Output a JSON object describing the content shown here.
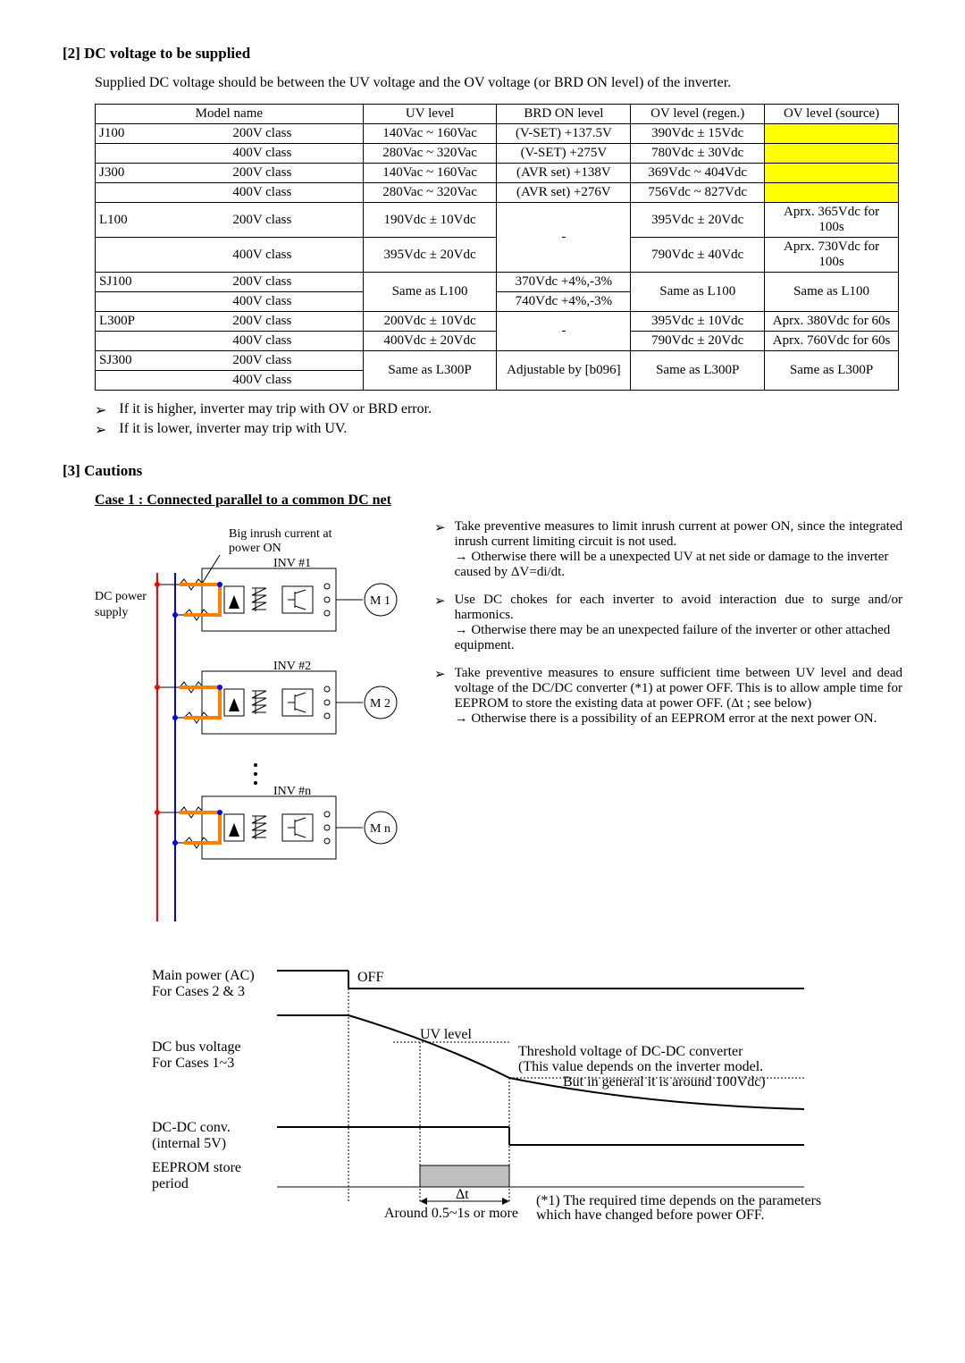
{
  "sec2": {
    "title": "[2] DC voltage to be supplied",
    "intro": "Supplied DC voltage should be between the UV voltage and the OV voltage (or BRD ON level) of the inverter.",
    "headers": [
      "Model name",
      "UV level",
      "BRD ON level",
      "OV level (regen.)",
      "OV level (source)"
    ],
    "rows": [
      {
        "model": "J100",
        "cls": "200V class",
        "uv": "140Vac ~ 160Vac",
        "brd": "(V-SET) +137.5V",
        "ovr": "390Vdc ± 15Vdc",
        "ovs": "",
        "hl": true
      },
      {
        "model": "",
        "cls": "400V class",
        "uv": "280Vac ~ 320Vac",
        "brd": "(V-SET) +275V",
        "ovr": "780Vdc ± 30Vdc",
        "ovs": "",
        "hl": true
      },
      {
        "model": "J300",
        "cls": "200V class",
        "uv": "140Vac ~ 160Vac",
        "brd": "(AVR set) +138V",
        "ovr": "369Vdc ~ 404Vdc",
        "ovs": "",
        "hl": true
      },
      {
        "model": "",
        "cls": "400V class",
        "uv": "280Vac ~ 320Vac",
        "brd": "(AVR set) +276V",
        "ovr": "756Vdc ~ 827Vdc",
        "ovs": "",
        "hl": true
      },
      {
        "model": "L100",
        "cls": "200V class",
        "uv": "190Vdc ± 10Vdc",
        "brd": "-",
        "ovr": "395Vdc ± 20Vdc",
        "ovs": "Aprx. 365Vdc for 100s",
        "merge_brd": 2
      },
      {
        "model": "",
        "cls": "400V class",
        "uv": "395Vdc ± 20Vdc",
        "brd": "",
        "ovr": "790Vdc ± 40Vdc",
        "ovs": "Aprx. 730Vdc for 100s"
      },
      {
        "model": "SJ100",
        "cls": "200V class",
        "uv": "Same as L100",
        "brd": "370Vdc +4%,-3%",
        "ovr": "Same as L100",
        "ovs": "Same as L100",
        "merge_uv": 2,
        "merge_ovr": 2,
        "merge_ovs": 2
      },
      {
        "model": "",
        "cls": "400V class",
        "uv": "",
        "brd": "740Vdc +4%,-3%",
        "ovr": "",
        "ovs": ""
      },
      {
        "model": "L300P",
        "cls": "200V class",
        "uv": "200Vdc ± 10Vdc",
        "brd": "-",
        "ovr": "395Vdc ± 10Vdc",
        "ovs": "Aprx. 380Vdc for 60s",
        "merge_brd": 2
      },
      {
        "model": "",
        "cls": "400V class",
        "uv": "400Vdc ± 20Vdc",
        "brd": "",
        "ovr": "790Vdc ± 20Vdc",
        "ovs": "Aprx. 760Vdc for 60s"
      },
      {
        "model": "SJ300",
        "cls": "200V class",
        "uv": "Same as L300P",
        "brd": "Adjustable by [b096]",
        "ovr": "Same as L300P",
        "ovs": "Same as L300P",
        "merge_uv": 2,
        "merge_brd": 2,
        "merge_ovr": 2,
        "merge_ovs": 2
      },
      {
        "model": "",
        "cls": "400V class",
        "uv": "",
        "brd": "",
        "ovr": "",
        "ovs": ""
      }
    ],
    "bullets": [
      "If it is higher, inverter may trip with OV or BRD error.",
      "If it is lower, inverter may trip with UV."
    ]
  },
  "sec3": {
    "title": "[3] Cautions",
    "case1": "Case 1 : Connected parallel to a common DC net",
    "diagram": {
      "inrush_label": "Big inrush current at power ON",
      "dc_supply": "DC power supply",
      "inv1": "INV #1",
      "inv2": "INV #2",
      "invn": "INV #n",
      "m1": "M 1",
      "m2": "M 2",
      "mn": "M n"
    },
    "notes": [
      {
        "main": "Take preventive measures to limit inrush current at power ON, since the integrated inrush current limiting circuit is not used.",
        "sub": "→ Otherwise there will be a unexpected UV at net side or damage to the inverter caused by ΔV=di/dt."
      },
      {
        "main": "Use DC chokes for each inverter to avoid interaction due to surge and/or harmonics.",
        "sub": "→ Otherwise there may be an unexpected failure of the inverter or other attached equipment."
      },
      {
        "main": "Take preventive measures to ensure sufficient time between UV level and dead voltage of the DC/DC converter (*1) at power OFF. This is to allow ample time for EEPROM to store the existing data at power OFF. (Δt ; see below)",
        "sub": "→ Otherwise there is a possibility of an EEPROM error at the next power ON."
      }
    ],
    "timing": {
      "main_power": "Main power (AC)",
      "for23": "For Cases 2 & 3",
      "off": "OFF",
      "dcbus": "DC bus voltage",
      "for13": "For Cases 1~3",
      "uvlevel": "UV level",
      "threshold1": "Threshold voltage of DC-DC converter",
      "threshold2": "(This value depends on the inverter model.",
      "threshold3": "But in general it is around 100Vdc)",
      "dcdc": "DC-DC conv.",
      "dcdc2": "(internal 5V)",
      "eeprom": "EEPROM store",
      "eeprom2": "period",
      "dt": "Δt",
      "around": "Around 0.5~1s or more",
      "fn1": "(*1) The required time depends on the parameters",
      "fn2": "which have changed before power OFF."
    }
  }
}
